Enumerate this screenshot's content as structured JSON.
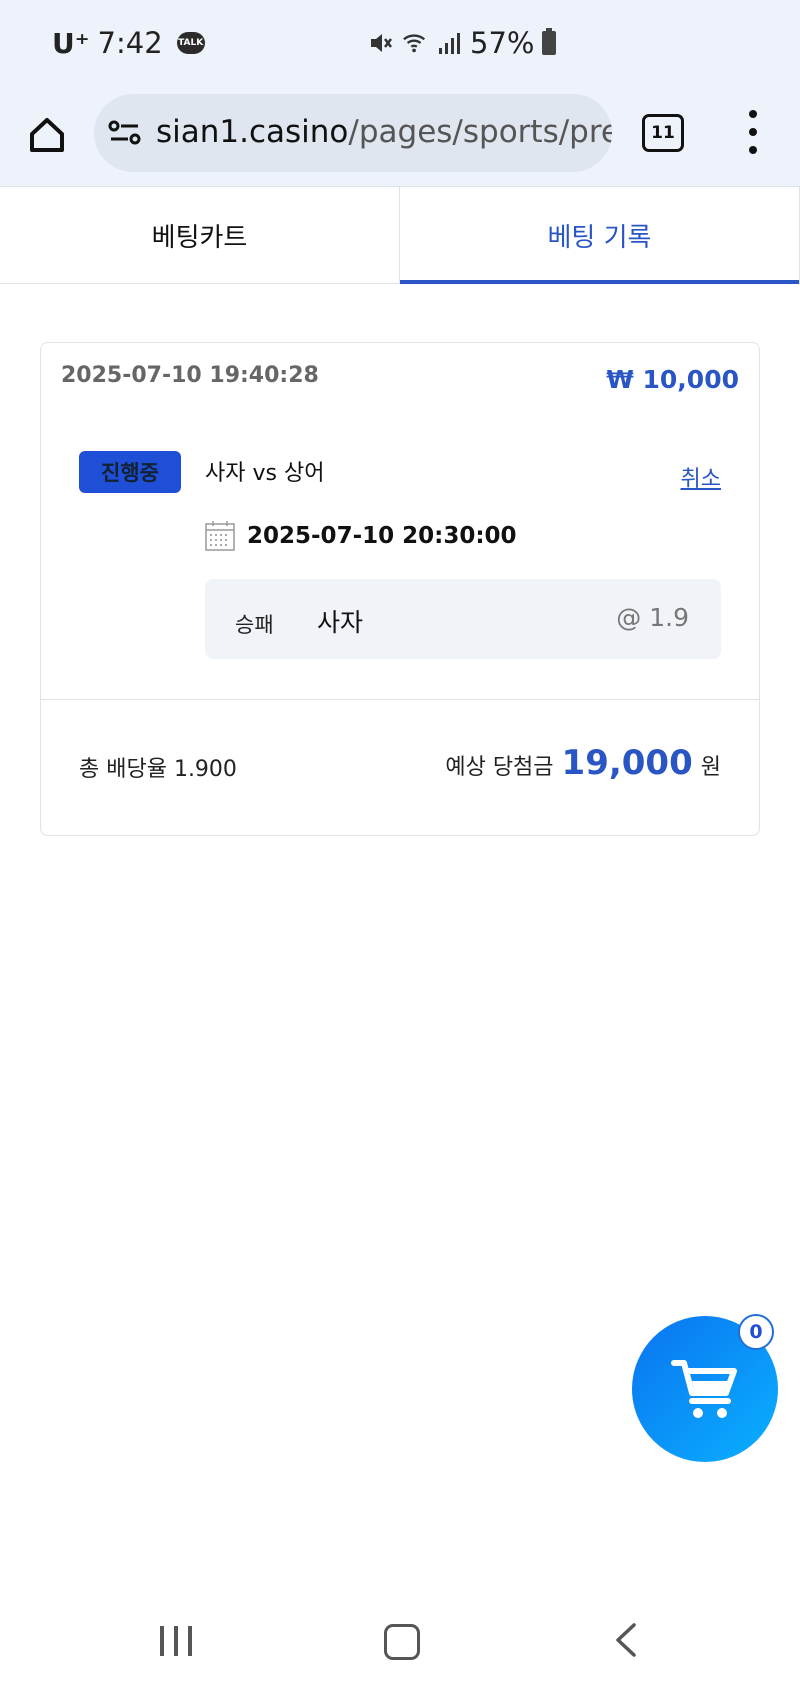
{
  "status_bar": {
    "carrier": "U⁺",
    "time": "7:42",
    "talk_badge": "TALK",
    "battery": "57%"
  },
  "browser": {
    "url_domain": "sian1.casino",
    "url_path": "/pages/sports/pre",
    "tab_count": "11"
  },
  "tabs": [
    {
      "label": "베팅카트",
      "active": false
    },
    {
      "label": "베팅 기록",
      "active": true
    }
  ],
  "bet": {
    "placed_at": "2025-07-10 19:40:28",
    "stake": "₩ 10,000",
    "status": "진행중",
    "match": "사자 vs 상어",
    "cancel": "취소",
    "match_time": "2025-07-10 20:30:00",
    "market": "승패",
    "selection": "사자",
    "odds": "@ 1.9",
    "total_odds": "총 배당율 1.900",
    "payout_label": "예상 당첨금",
    "payout_amount": "19,000",
    "payout_unit": "원"
  },
  "cart": {
    "count": "0"
  },
  "colors": {
    "accent": "#2956c4",
    "badge": "#1f4fd6",
    "fab": "#0a8cf5"
  }
}
